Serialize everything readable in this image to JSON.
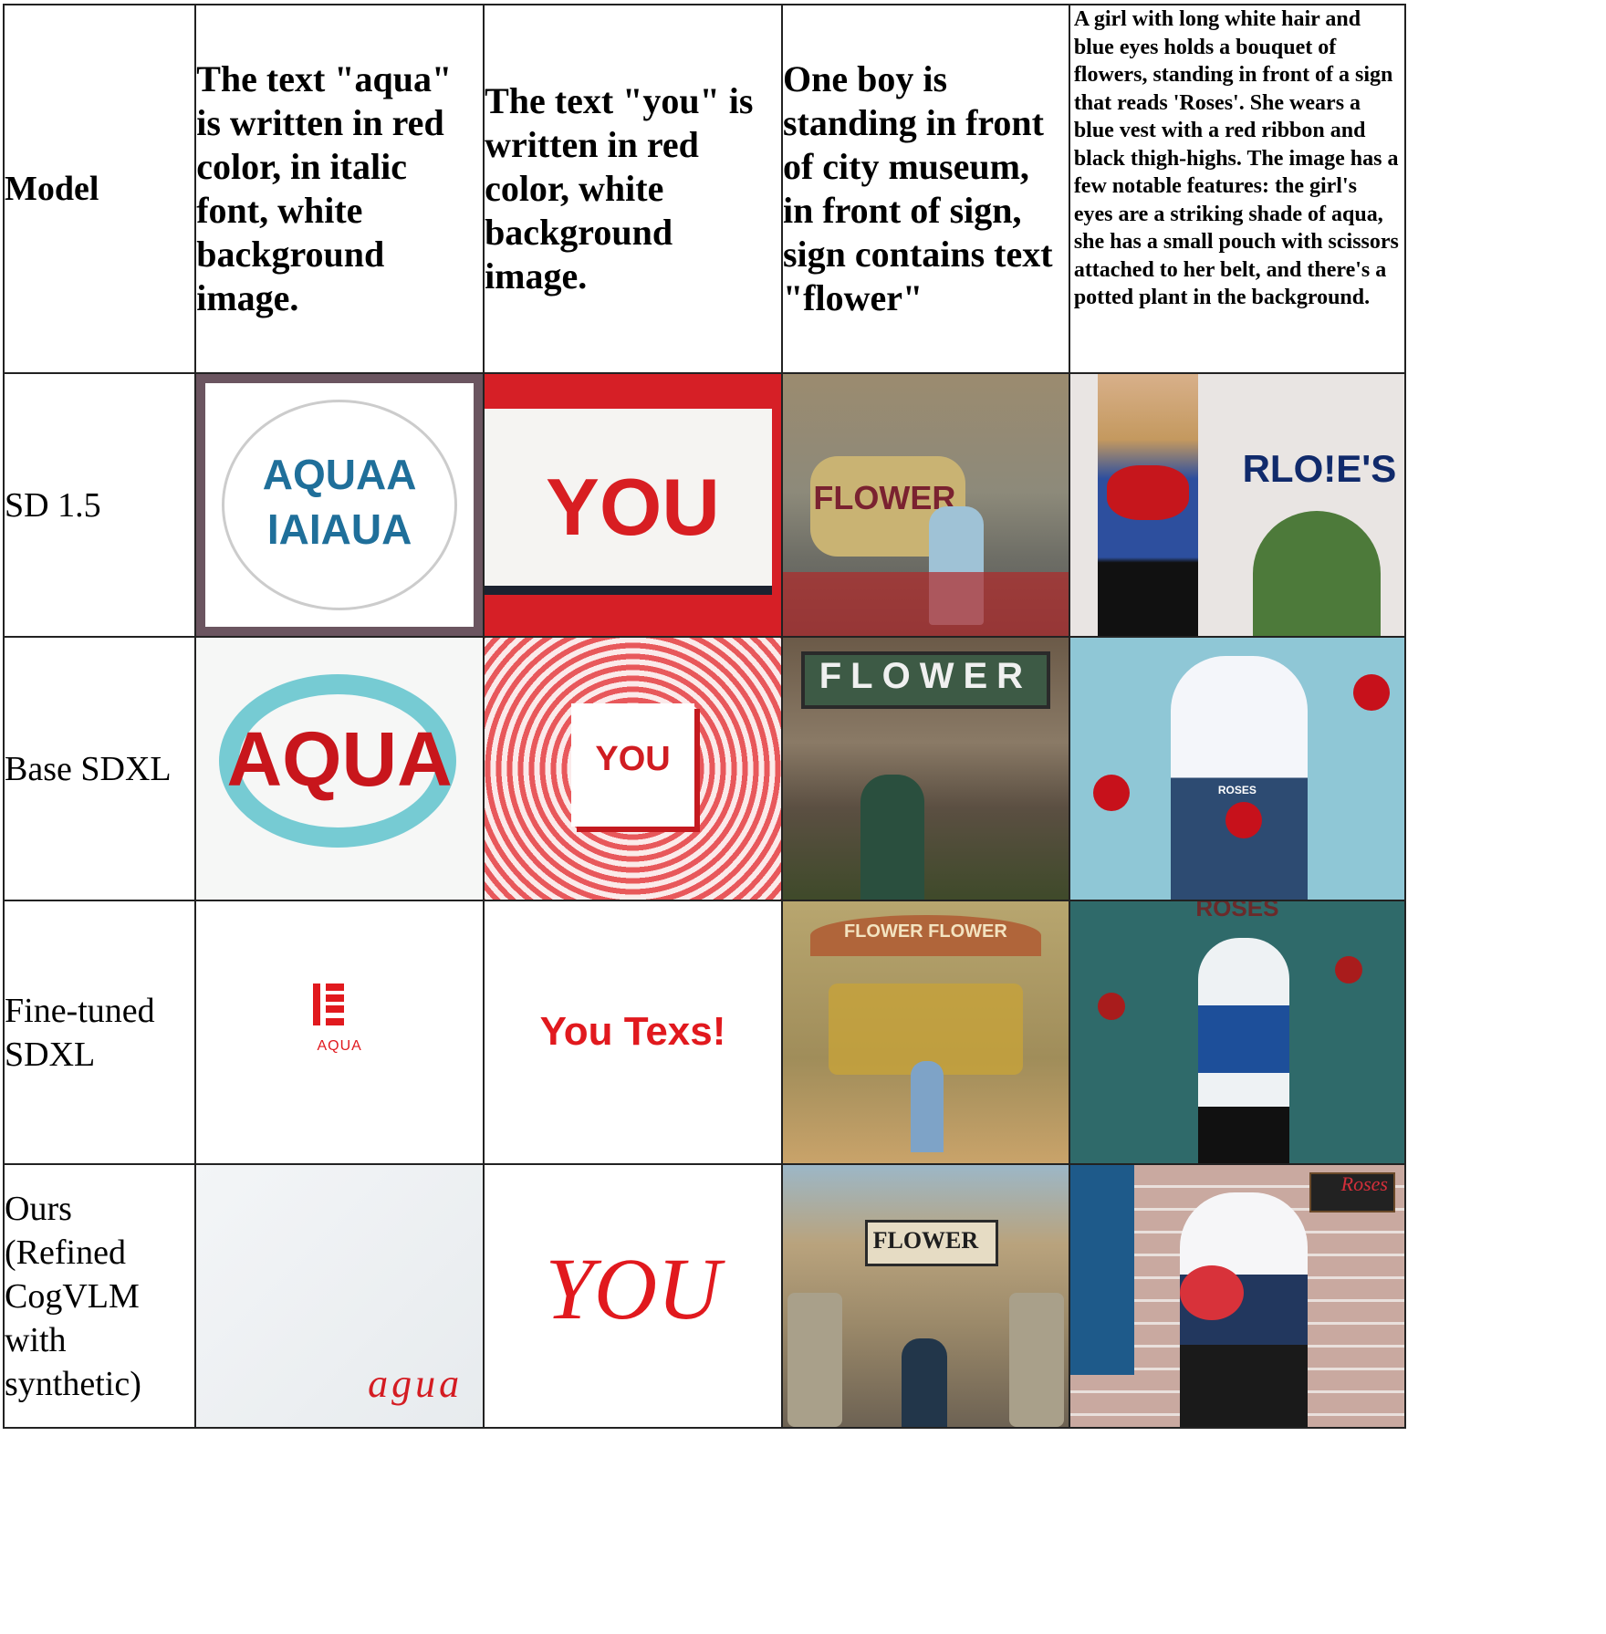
{
  "header": {
    "model_label": "Model",
    "prompts": [
      "The text \"aqua\" is written in red color, in italic font, white background image.",
      "The text \"you\" is written in red color, white background image.",
      "One boy is standing in front of city museum, in front of sign, sign contains text \"flower\"",
      "A girl with long white hair and blue eyes holds a bouquet of flowers, standing in front of a sign that reads 'Roses'. She wears a blue vest with a red ribbon and black thigh-highs. The image has a few notable features: the girl's eyes are a striking shade of aqua, she has a small pouch with scissors attached to her belt, and there's a potted plant in the background."
    ]
  },
  "rows": [
    {
      "model": "SD 1.5",
      "cells": [
        {
          "desc": "ornamental frame with blue text",
          "text": "AQUAA\nIAIAUA",
          "text_color": "#1f6f9a",
          "bg": "#ffffff",
          "frame": "#6b5560"
        },
        {
          "desc": "red-framed white sign",
          "text": "YOU",
          "text_color": "#d81e22",
          "bg": "#d61f26"
        },
        {
          "desc": "boy in front of flower sign",
          "text": "FLOWER",
          "text_color": "#7a2230",
          "bg": "#8d8a7a"
        },
        {
          "desc": "woman holding roses beside sign",
          "text": "RLO!E'S",
          "text_color": "#102a6b",
          "bg": "#e9e5e3"
        }
      ]
    },
    {
      "model": "Base SDXL",
      "cells": [
        {
          "desc": "red text over aqua splash",
          "text": "AQUA",
          "text_color": "#c8161c",
          "bg": "#f6f7f6"
        },
        {
          "desc": "white card on red speckles",
          "text": "YOU",
          "text_color": "#d01d22",
          "bg": "#e8585b"
        },
        {
          "desc": "boy below flower sign",
          "text": "FLOWER",
          "text_color": "#f0f0f0",
          "bg": "#5b4f42"
        },
        {
          "desc": "anime girl with roses",
          "text": "ROSES",
          "text_color": "#ffffff",
          "bg": "#8fc7d6"
        }
      ]
    },
    {
      "model": "Fine-tuned SDXL",
      "cells": [
        {
          "desc": "minimal red logo",
          "text": "AQUA",
          "text_color": "#e1191e",
          "bg": "#ffffff"
        },
        {
          "desc": "red text on white",
          "text": "You Texs!",
          "text_color": "#e1191e",
          "bg": "#ffffff"
        },
        {
          "desc": "boy in flower hall",
          "text": "FLOWER FLOWER",
          "text_color": "#f3e3c0",
          "bg": "#b8a66f"
        },
        {
          "desc": "anime girl in rose bushes",
          "text": "ROSES",
          "text_color": "#6b2a2a",
          "bg": "#2f6a6a"
        }
      ]
    },
    {
      "model": "Ours (Refined CogVLM with synthetic)",
      "cells": [
        {
          "desc": "italic red text bottom right",
          "text": "agua",
          "text_color": "#d41c22",
          "bg": "#eef1f3"
        },
        {
          "desc": "red decorative text",
          "text": "YOU",
          "text_color": "#e1191e",
          "bg": "#ffffff"
        },
        {
          "desc": "boy in front of flower museum",
          "text": "FLOWER",
          "text_color": "#1e1e1e",
          "bg": "#9c8a6a"
        },
        {
          "desc": "anime girl with bouquet by brick wall",
          "text": "Roses",
          "text_color": "#d32f3a",
          "bg": "#c9a9a0"
        }
      ]
    }
  ]
}
